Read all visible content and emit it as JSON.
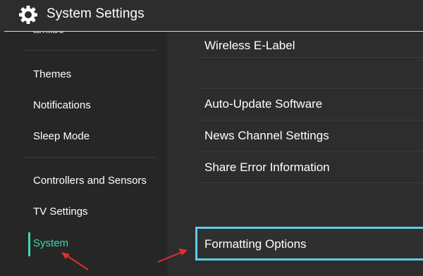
{
  "header": {
    "title": "System Settings",
    "icon": "gear-icon"
  },
  "sidebar": {
    "items": [
      {
        "label": "amiibo"
      },
      {
        "label": "Themes"
      },
      {
        "label": "Notifications"
      },
      {
        "label": "Sleep Mode"
      },
      {
        "label": "Controllers and Sensors"
      },
      {
        "label": "TV Settings"
      },
      {
        "label": "System"
      }
    ],
    "selected": "System"
  },
  "content": {
    "rows": [
      {
        "label": "Wireless E-Label"
      },
      {
        "label": ""
      },
      {
        "label": "Auto-Update Software"
      },
      {
        "label": "News Channel Settings"
      },
      {
        "label": "Share Error Information"
      }
    ],
    "focused_row": {
      "label": "Formatting Options"
    }
  },
  "colors": {
    "selection": "#3fd8b0",
    "focus_border": "#5ccde8",
    "annotation_arrow": "#e0302a"
  }
}
